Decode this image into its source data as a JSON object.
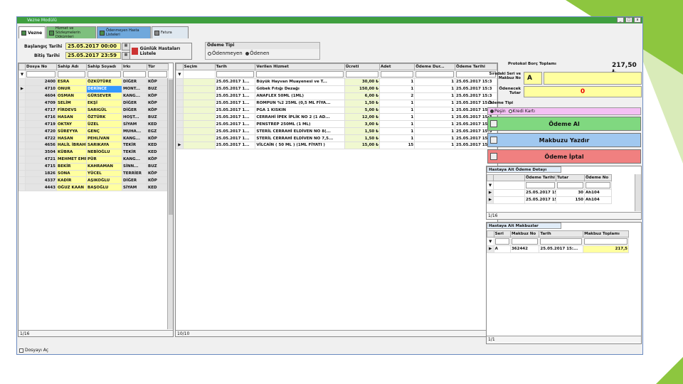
{
  "window": {
    "title": "Vezne Modülü"
  },
  "tabs": [
    {
      "label": "Vezne"
    },
    {
      "label": "Hizmet ve Sözleşmelerin Dökümleri"
    },
    {
      "label": "Ödenmeyen Hasta Listeleri"
    },
    {
      "label": "Fatura"
    }
  ],
  "filters": {
    "start_label": "Başlangıç Tarihi",
    "start_value": "25.05.2017 00:00",
    "end_label": "Bitiş Tarihi",
    "end_value": "25.05.2017 23:59",
    "list_button": "Günlük Hastaları Listele"
  },
  "payment_type": {
    "label": "Ödeme Tipi",
    "option1": "Ödenmeyen",
    "option2": "Ödenen"
  },
  "patients": {
    "columns": [
      "Dosya No",
      "Sahip Adı",
      "Sahip Soyadı",
      "Irkı",
      "Tür"
    ],
    "rows": [
      [
        "2400",
        "ESRA",
        "ÖZKÜTÜRE",
        "DİĞER",
        "KÖP"
      ],
      [
        "4710",
        "ONUR",
        "DERİNCE",
        "MONT...",
        "BUZ"
      ],
      [
        "4604",
        "OSMAN",
        "GÜRSEVER",
        "KANG...",
        "KÖP"
      ],
      [
        "4709",
        "SELİM",
        "EKŞİ",
        "DİĞER",
        "KÖP"
      ],
      [
        "4717",
        "FİRDEVS",
        "SARIGÜL",
        "DİĞER",
        "KÖP"
      ],
      [
        "4716",
        "HASAN",
        "ÖZTÜRK",
        "HOŞT...",
        "BUZ"
      ],
      [
        "4719",
        "OKTAY",
        "ÜZEL",
        "SİYAM",
        "KED"
      ],
      [
        "4720",
        "SÜREYYA",
        "GENÇ",
        "MUHA...",
        "EGZ"
      ],
      [
        "4722",
        "HASAN",
        "PEHLİVAN",
        "KANG...",
        "KÖP"
      ],
      [
        "4656",
        "HALİL İBRAHİ...",
        "SARIKAYA",
        "TEKİR",
        "KED"
      ],
      [
        "3504",
        "KÜBRA",
        "NEBİOĞLU",
        "TEKİR",
        "KED"
      ],
      [
        "4721",
        "MEHMET EMRE",
        "PÜR",
        "KANG...",
        "KÖP"
      ],
      [
        "4715",
        "BEKİR",
        "KAHRAMAN",
        "SİNN...",
        "BUZ"
      ],
      [
        "1826",
        "SONA",
        "YÜCEL",
        "TERRİER",
        "KÖP"
      ],
      [
        "4337",
        "KADİR",
        "AŞIKOĞLU",
        "DİĞER",
        "KÖP"
      ],
      [
        "4443",
        "OĞUZ KAAN",
        "BAŞOĞLU",
        "SİYAM",
        "KED"
      ]
    ],
    "footer": "1/16"
  },
  "services": {
    "columns": [
      "Seçim",
      "Tarih",
      "Verilen Hizmet",
      "Ücreti",
      "Adet",
      "Ödeme Dur...",
      "Ödeme Tarihi"
    ],
    "rows": [
      [
        "25.05.2017 1...",
        "Büyük Hayvan Muayenesi ve T...",
        "30,00 ₺",
        "1",
        "1",
        "25.05.2017 15:3"
      ],
      [
        "25.05.2017 1...",
        "Göbek Fıtığı Dezağı",
        "150,00 ₺",
        "1",
        "1",
        "25.05.2017 15:3"
      ],
      [
        "25.05.2017 1...",
        "ANAFLEX 50ML (1ML)",
        "6,00 ₺",
        "2",
        "1",
        "25.05.2017 15:3"
      ],
      [
        "25.05.2017 1...",
        "ROMPUN %2 25ML (0,5 ML FİYA...",
        "1,50 ₺",
        "1",
        "1",
        "25.05.2017 15:3"
      ],
      [
        "25.05.2017 1...",
        "PGA 1 KISKIN",
        "5,00 ₺",
        "1",
        "1",
        "25.05.2017 15:3"
      ],
      [
        "25.05.2017 1...",
        "CERRAHİ İPEK İPLİK NO 2 (1 AD...",
        "12,00 ₺",
        "1",
        "1",
        "25.05.2017 15:3"
      ],
      [
        "25.05.2017 1...",
        "PENSTREP 250ML (1 ML)",
        "3,00 ₺",
        "1",
        "1",
        "25.05.2017 15:3"
      ],
      [
        "25.05.2017 1...",
        "STERİL CERRAHİ ELDİVEN NO 8(...",
        "1,50 ₺",
        "1",
        "1",
        "25.05.2017 15:3"
      ],
      [
        "25.05.2017 1...",
        "STERİL CERRAHİ ELDİVEN NO 7,5...",
        "1,50 ₺",
        "1",
        "1",
        "25.05.2017 15:3"
      ],
      [
        "25.05.2017 1...",
        "VİLCAİN ( 50 ML ) (1ML FİYATI )",
        "15,00 ₺",
        "15",
        "1",
        "25.05.2017 15:3"
      ]
    ],
    "footer": "10/10"
  },
  "right": {
    "debt_label": "Protokol Borç Toplamı",
    "debt_value": "217,50 ₺",
    "serial_label": "Sıradaki Seri ve Makbuz No",
    "serial_value": "A",
    "due_label": "Ödenecek Tutar",
    "due_value": "0",
    "pay_type_label": "Ödeme Tipi",
    "cash": "Peşin",
    "card": "Kredi Kartı",
    "btn_receive": "Ödeme Al",
    "btn_print": "Makbuzu Yazdır",
    "btn_cancel": "Ödeme İptal"
  },
  "payments": {
    "header": "Hastaya Ait Ödeme Detayı",
    "columns": [
      "Ödeme Tarihi",
      "Tutar",
      "Ödeme No"
    ],
    "rows": [
      [
        "25.05.2017 15:3...",
        "30",
        "Ah104"
      ],
      [
        "25.05.2017 15:3...",
        "150",
        "Ah104"
      ]
    ],
    "footer": "1/16"
  },
  "receipts": {
    "header": "Hastaya Ait Makbuzlar",
    "columns": [
      "Seri",
      "Makbuz No",
      "Tarih",
      "Makbuz Toplamı"
    ],
    "rows": [
      [
        "A",
        "362442",
        "25.05.2017 15:...",
        "217,5"
      ]
    ],
    "footer": "1/1"
  },
  "bottom": {
    "checkbox_label": "Dosyayı Aç"
  },
  "colors": {
    "accent_green": "#8dc63f",
    "highlight_yellow": "#ffffa0",
    "receive_btn": "#80d880",
    "print_btn": "#a0c8f0",
    "cancel_btn": "#f08080"
  }
}
